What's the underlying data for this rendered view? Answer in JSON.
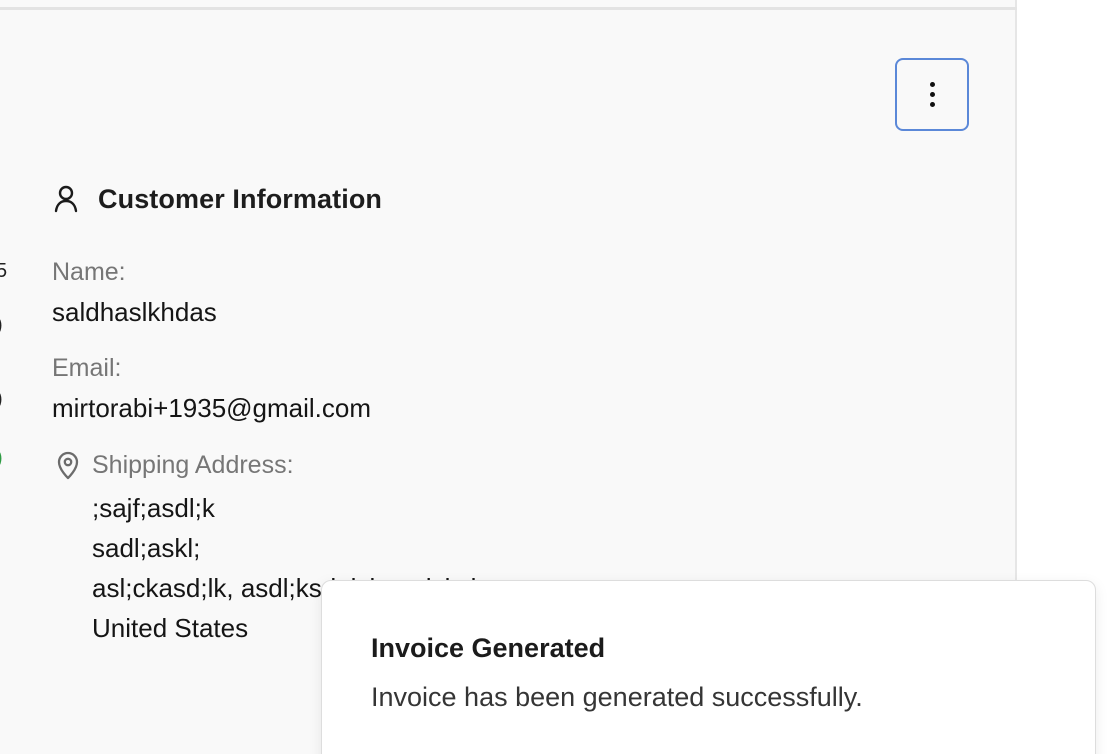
{
  "actions": {
    "more_button_label": "More options",
    "icon": "more-vertical-icon"
  },
  "customer_information": {
    "title": "Customer Information",
    "icon": "user-icon",
    "fields": {
      "name_label": "Name:",
      "name_value": "saldhaslkhdas",
      "email_label": "Email:",
      "email_value": "mirtorabi+1935@gmail.com",
      "shipping_label": "Shipping Address:",
      "shipping_icon": "map-pin-icon",
      "shipping_lines": [
        ";sajf;asdl;k",
        "sadl;askl;",
        "asl;ckasd;lk, asdl;ksdalsk sadsksk",
        "United States"
      ]
    }
  },
  "toast": {
    "title": "Invoice Generated",
    "message": "Invoice has been generated successfully."
  },
  "colors": {
    "panel_background": "#f9f9f9",
    "focus_border": "#5b88d8",
    "label_gray": "#767676",
    "text_dark": "#151515"
  }
}
